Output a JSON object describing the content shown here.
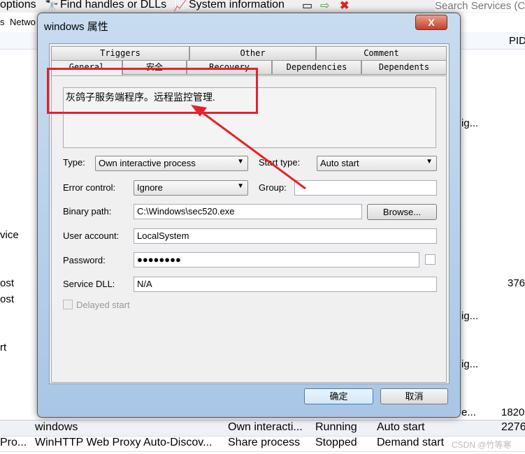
{
  "toolbar": {
    "options": "options",
    "find": "Find handles or DLLs",
    "sysinfo": "System information",
    "search_placeholder": "Search Services (C"
  },
  "tabs_bg": {
    "services": "s",
    "network": "Netwo"
  },
  "columns": {
    "pid": "PID"
  },
  "bg_fragments": {
    "left": [
      "vice",
      "ost",
      "ost",
      "rt"
    ],
    "right": [
      "ig...",
      "ig...",
      "ig...",
      "ig...",
      "e..."
    ],
    "pids": [
      "376",
      "1820"
    ]
  },
  "rows": [
    {
      "left": "",
      "name": "windows",
      "type": "Own interacti...",
      "status": "Running",
      "start": "Auto start",
      "pid": "2276"
    },
    {
      "left": "Pro...",
      "name": "WinHTTP Web Proxy Auto-Discov...",
      "type": "Share process",
      "status": "Stopped",
      "start": "Demand start",
      "pid": ""
    }
  ],
  "dialog": {
    "title": "windows 属性",
    "close": "X",
    "tabs_row1": [
      "Triggers",
      "Other",
      "Comment"
    ],
    "tabs_row2": [
      "General",
      "安全",
      "Recovery",
      "Dependencies",
      "Dependents"
    ],
    "description": "灰鸽子服务端程序。远程监控管理.",
    "type_label": "Type:",
    "type_value": "Own interactive process",
    "start_type_label": "Start type:",
    "start_type_value": "Auto start",
    "error_label": "Error control:",
    "error_value": "Ignore",
    "group_label": "Group:",
    "group_value": "",
    "binary_label": "Binary path:",
    "binary_value": "C:\\Windows\\sec520.exe",
    "browse": "Browse...",
    "account_label": "User account:",
    "account_value": "LocalSystem",
    "password_label": "Password:",
    "password_value": "●●●●●●●●",
    "dll_label": "Service DLL:",
    "dll_value": "N/A",
    "delayed": "Delayed start",
    "ok": "确定",
    "cancel": "取消"
  },
  "watermark": "CSDN @竹等寒",
  "annotation_color": "#e8202a"
}
